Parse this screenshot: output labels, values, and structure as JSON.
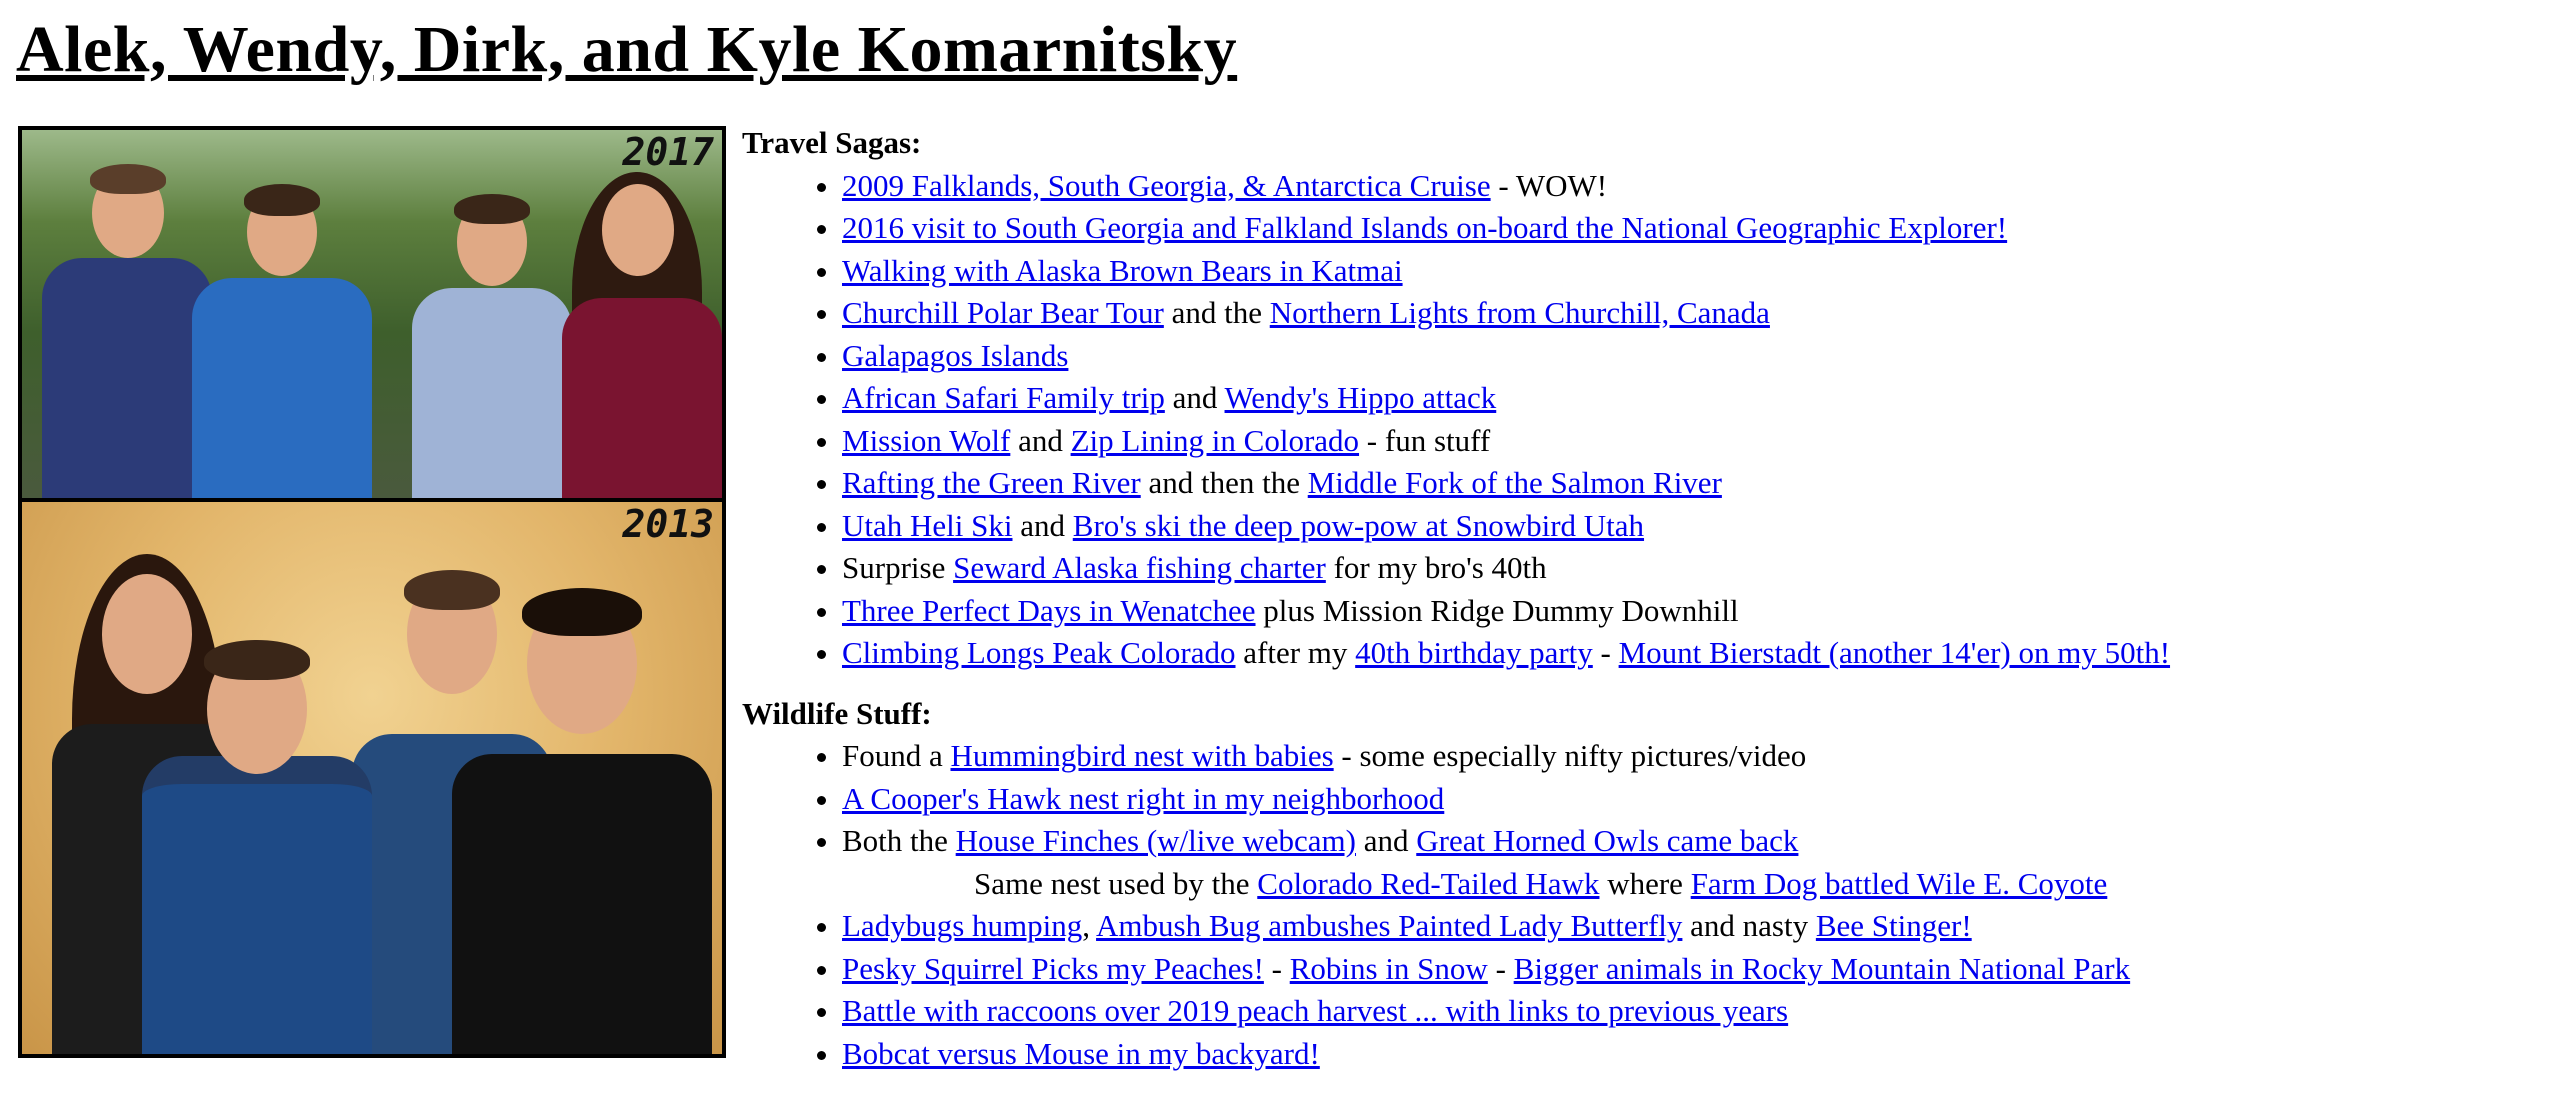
{
  "page_title": "Alek, Wendy, Dirk, and Kyle Komarnitsky",
  "photos": {
    "top_year": "2017",
    "bottom_year": "2013"
  },
  "travel": {
    "title": "Travel Sagas:",
    "items": [
      {
        "link1": "2009 Falklands, South Georgia, & Antarctica Cruise",
        "text1": " - WOW!"
      },
      {
        "link1": "2016 visit to South Georgia and Falkland Islands on-board the National Geographic Explorer!"
      },
      {
        "link1": "Walking with Alaska Brown Bears in Katmai"
      },
      {
        "link1": "Churchill Polar Bear Tour",
        "text1": " and the ",
        "link2": "Northern Lights from Churchill, Canada"
      },
      {
        "link1": "Galapagos Islands"
      },
      {
        "link1": "African Safari Family trip",
        "text1": " and ",
        "link2": "Wendy's Hippo attack"
      },
      {
        "link1": "Mission Wolf",
        "text1": " and ",
        "link2": "Zip Lining in Colorado",
        "text2": " - fun stuff"
      },
      {
        "link1": "Rafting the Green River",
        "text1": " and then the ",
        "link2": "Middle Fork of the Salmon River"
      },
      {
        "link1": "Utah Heli Ski",
        "text1": " and ",
        "link2": "Bro's ski the deep pow-pow at Snowbird Utah"
      },
      {
        "text0": "Surprise ",
        "link1": "Seward Alaska fishing charter",
        "text1": " for my bro's 40th"
      },
      {
        "link1": "Three Perfect Days in Wenatchee",
        "text1": " plus Mission Ridge Dummy Downhill"
      },
      {
        "link1": "Climbing Longs Peak Colorado",
        "text1": " after my ",
        "link2": "40th birthday party",
        "text2": " - ",
        "link3": "Mount Bierstadt (another 14'er) on my 50th!"
      }
    ]
  },
  "wildlife": {
    "title": "Wildlife Stuff:",
    "items": [
      {
        "text0": "Found a ",
        "link1": "Hummingbird nest with babies",
        "text1": " - some especially nifty pictures/video"
      },
      {
        "link1": "A Cooper's Hawk nest right in my neighborhood"
      },
      {
        "text0": "Both the ",
        "link1": "House Finches (w/live webcam)",
        "text1": " and ",
        "link2": "Great Horned Owls came back"
      },
      {
        "link1": "Ladybugs humping",
        "text1": ", ",
        "link2": "Ambush Bug ambushes Painted Lady Butterfly",
        "text2": " and nasty ",
        "link3": "Bee Stinger!"
      },
      {
        "link1": "Pesky Squirrel Picks my Peaches!",
        "text1": " - ",
        "link2": "Robins in Snow",
        "text2": " - ",
        "link3": "Bigger animals in Rocky Mountain National Park"
      },
      {
        "link1": "Battle with raccoons over 2019 peach harvest ... with links to previous years"
      },
      {
        "link1": "Bobcat versus Mouse in my backyard!"
      }
    ],
    "nest_note": {
      "text0": "Same nest used by the ",
      "link1": "Colorado Red-Tailed Hawk",
      "text1": " where ",
      "link2": "Farm Dog battled Wile E. Coyote"
    }
  },
  "colors": {
    "link": "#0000ee",
    "text": "#000000",
    "background": "#ffffff"
  }
}
